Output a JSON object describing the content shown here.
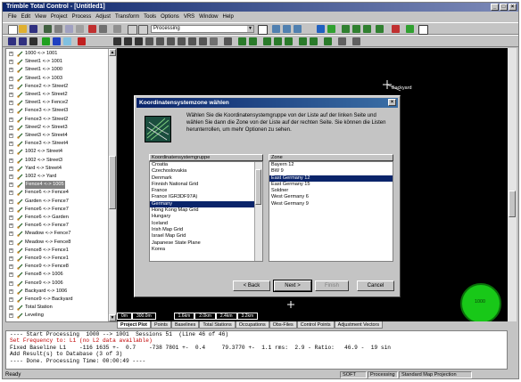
{
  "window": {
    "title": "Trimble Total Control - [Untitled1]"
  },
  "title_buttons": [
    "_",
    "□",
    "×"
  ],
  "menu": [
    "File",
    "Edit",
    "View",
    "Project",
    "Process",
    "Adjust",
    "Transform",
    "Tools",
    "Options",
    "VRS",
    "Window",
    "Help"
  ],
  "toolbar": {
    "processing_combo": "Processing"
  },
  "tree": {
    "items": [
      {
        "label": "1000 <-> 1001",
        "selected": false
      },
      {
        "label": "Street1 <-> 1001",
        "selected": false
      },
      {
        "label": "Street1 <-> 1000",
        "selected": false
      },
      {
        "label": "Street1 <-> 1003",
        "selected": false
      },
      {
        "label": "Fence2 <-> Street2",
        "selected": false
      },
      {
        "label": "Street1 <-> Street2",
        "selected": false
      },
      {
        "label": "Street1 <-> Fence2",
        "selected": false
      },
      {
        "label": "Fence3 <-> Street3",
        "selected": false
      },
      {
        "label": "Fence3 <-> Street2",
        "selected": false
      },
      {
        "label": "Street2 <-> Street3",
        "selected": false
      },
      {
        "label": "Street3 <-> Street4",
        "selected": false
      },
      {
        "label": "Fence3 <-> Street4",
        "selected": false
      },
      {
        "label": "1002 <-> Street4",
        "selected": false
      },
      {
        "label": "1002 <-> Street3",
        "selected": false
      },
      {
        "label": "Yard <-> Street4",
        "selected": false
      },
      {
        "label": "1002 <-> Yard",
        "selected": false
      },
      {
        "label": "Fence4 <-> 1005",
        "selected": true
      },
      {
        "label": "Fence6 <-> Fence4",
        "selected": false
      },
      {
        "label": "Garden <-> Fence7",
        "selected": false
      },
      {
        "label": "Fence6 <-> Fence7",
        "selected": false
      },
      {
        "label": "Fence6 <-> Garden",
        "selected": false
      },
      {
        "label": "Fence6 <-> Fence7",
        "selected": false
      },
      {
        "label": "Meadow <-> Fence7",
        "selected": false
      },
      {
        "label": "Meadow <-> Fence8",
        "selected": false
      },
      {
        "label": "Fence8 <-> Fence1",
        "selected": false
      },
      {
        "label": "Fence9 <-> Fence1",
        "selected": false
      },
      {
        "label": "Fence9 <-> Fence8",
        "selected": false
      },
      {
        "label": "Fence8 <-> 1006",
        "selected": false
      },
      {
        "label": "Fence9 <-> 1006",
        "selected": false
      },
      {
        "label": "Backyard <-> 1006",
        "selected": false
      },
      {
        "label": "Fence9 <-> Backyard",
        "selected": false
      },
      {
        "label": "Total Station",
        "selected": false
      },
      {
        "label": "Leveling",
        "selected": false
      }
    ]
  },
  "map": {
    "label_backyard": "Backyard",
    "scale": [
      "0m",
      "300.0m",
      "1.6km",
      "2.0km",
      "2.4km",
      "3.2km"
    ],
    "green_label": "1000"
  },
  "tabs": [
    "Project Plot",
    "Points",
    "Baselines",
    "Total Stations",
    "Occupations",
    "Obs-Files",
    "Control Points",
    "Adjustment Vectors"
  ],
  "output": [
    {
      "text": "---- Start Processing  1000 --> 1001  Sessions 51  (Line 46 of 46)",
      "red": false
    },
    {
      "text": "Set Frequency to: L1 (no L2 data available)",
      "red": true
    },
    {
      "text": "Fixed Baseline L1    -116 1635 +-  0.7    -738 7801 +-  0.4     79.3770 +-  1.1 rms:  2.9 - Ratio:   46.9 -  19 sin",
      "red": false
    },
    {
      "text": "Add Result(s) to Database (3 of 3)",
      "red": false
    },
    {
      "text": "---- Done. Processing Time: 00:00:49 ----",
      "red": false
    }
  ],
  "status": {
    "ready": "Ready",
    "mode": "SOFT",
    "processing": "Processing",
    "projection": "Standard Map Projection"
  },
  "dialog": {
    "title": "Koordinatensystemzone wählen",
    "description": "Wählen Sie die Koordinatensystemgruppe von der Liste auf der linken Seite und wählen Sie dann die Zone von der Liste auf der rechten Seite. Sie können die Listen herunterrollen, um mehr Optionen zu sehen.",
    "left_header": "Koordinatensystemgruppe",
    "left_items": [
      "Croatia",
      "Czechoslovakia",
      "Denmark",
      "Finnish National Grid",
      "France",
      "France IGR3DF97A)",
      "Germany",
      "Hong Kong Map Grid",
      "Hungary",
      "Iceland",
      "Irish Map Grid",
      "Israel Map Grid",
      "Japanese State Plane",
      "Korea"
    ],
    "left_selected": "Germany",
    "right_header": "Zone",
    "right_items": [
      "Bayern 12",
      "BW 9",
      "East Germany 12",
      "East Germany 15",
      "Soldner",
      "West Germany 6",
      "West Germany 9"
    ],
    "right_selected": "East Germany 12",
    "buttons": {
      "back": "< Back",
      "next": "Next >",
      "finish": "Finish",
      "cancel": "Cancel"
    }
  },
  "colors": {
    "title_blue": "#0a246a",
    "selection": "#0a246a",
    "map_bg": "#000000",
    "error_red": "#c00000"
  }
}
